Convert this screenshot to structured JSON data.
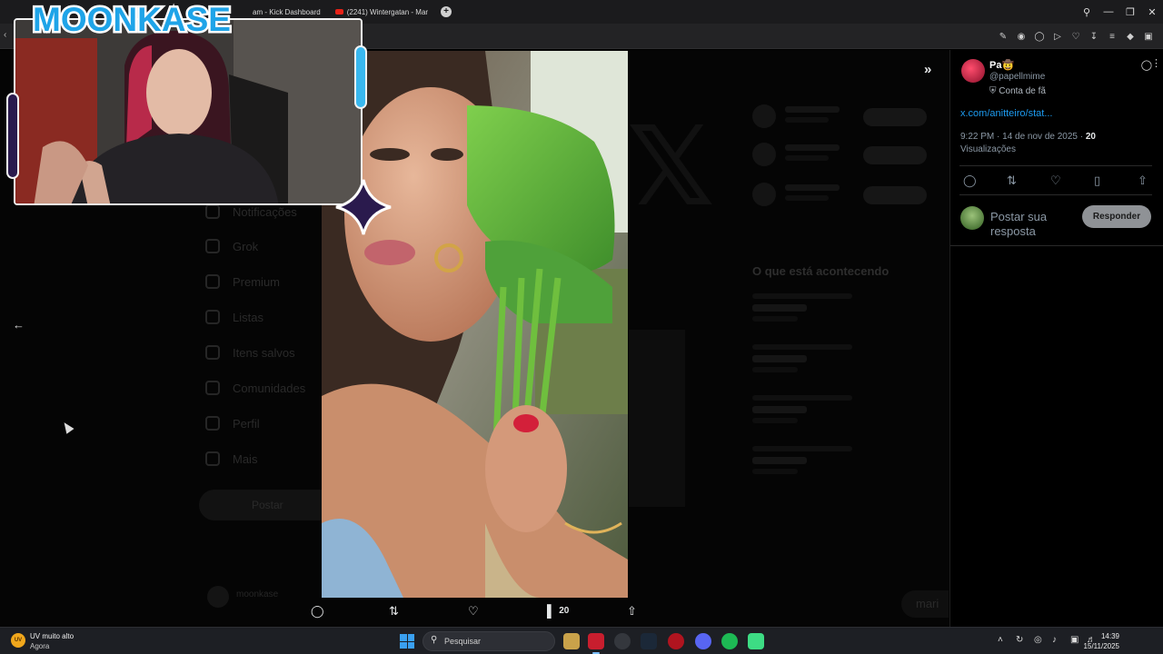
{
  "browser": {
    "tabs": [
      {
        "label": "am - Kick Dashboard"
      },
      {
        "label": "(2241) Wintergatan - Mar"
      }
    ],
    "new_tab_label": "+",
    "window_controls": [
      "search-icon",
      "minimize-icon",
      "restore-icon",
      "close-icon"
    ],
    "toolbar_icons": [
      "edit-icon",
      "camera-icon",
      "shield-icon",
      "play-icon",
      "heart-icon",
      "download-icon",
      "menu-icon",
      "lock-icon",
      "extension-icon"
    ]
  },
  "overlay": {
    "brand": "MOONKASE"
  },
  "background_page": {
    "nav_items": [
      {
        "label": "Notificações",
        "icon": "bell-icon"
      },
      {
        "label": "Grok",
        "icon": "grok-icon"
      },
      {
        "label": "Premium",
        "icon": "x-icon"
      },
      {
        "label": "Listas",
        "icon": "list-icon"
      },
      {
        "label": "Itens salvos",
        "icon": "bookmark-icon"
      },
      {
        "label": "Comunidades",
        "icon": "people-icon"
      },
      {
        "label": "Perfil",
        "icon": "person-icon"
      },
      {
        "label": "Mais",
        "icon": "more-icon"
      }
    ],
    "post_button": "Postar",
    "user_name": "moonkase",
    "trends_heading": "O que está acontecendo",
    "reply_side": "mari"
  },
  "media": {
    "actions": {
      "views": "20"
    }
  },
  "tweet": {
    "author_name": "Pa🤠",
    "author_handle": "@papellmime",
    "fan_label": "Conta de fã",
    "link": "x.com/anitteiro/stat...",
    "timestamp": "9:22 PM · 14 de nov de 2025 · ",
    "views_count": "20",
    "views_label": "Visualizações",
    "reply_placeholder": "Postar sua resposta",
    "reply_button": "Responder"
  },
  "taskbar": {
    "weather_title": "UV muito alto",
    "weather_sub": "Agora",
    "weather_badge": "UV",
    "search_label": "Pesquisar",
    "time": "14:39",
    "date": "15/11/2025"
  },
  "colors": {
    "accent_link": "#1d9bf0",
    "brand_blue": "#1fa4e8",
    "brand_purple": "#2a1a4d",
    "taskbar_bg": "#1d1f24"
  }
}
